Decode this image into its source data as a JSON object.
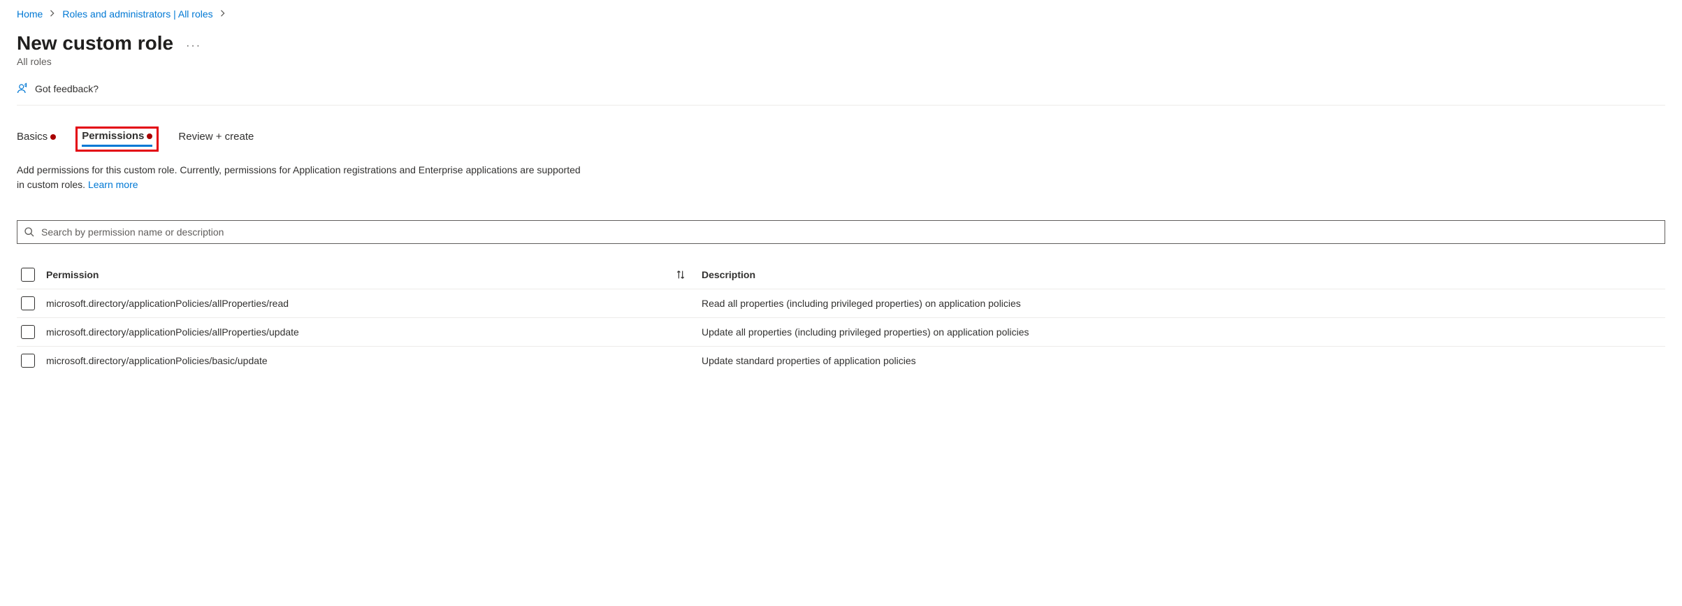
{
  "breadcrumb": {
    "home": "Home",
    "roles": "Roles and administrators | All roles"
  },
  "title": "New custom role",
  "subtitle": "All roles",
  "feedback_label": "Got feedback?",
  "tabs": {
    "basics": "Basics",
    "permissions": "Permissions",
    "review": "Review + create"
  },
  "description": {
    "line1": "Add permissions for this custom role. Currently, permissions for Application registrations and Enterprise applications are supported",
    "line2_prefix": "in custom roles. ",
    "learn_more": "Learn more"
  },
  "search": {
    "placeholder": "Search by permission name or description"
  },
  "table": {
    "headers": {
      "permission": "Permission",
      "description": "Description"
    },
    "rows": [
      {
        "perm": "microsoft.directory/applicationPolicies/allProperties/read",
        "desc": "Read all properties (including privileged properties) on application policies"
      },
      {
        "perm": "microsoft.directory/applicationPolicies/allProperties/update",
        "desc": "Update all properties (including privileged properties) on application policies"
      },
      {
        "perm": "microsoft.directory/applicationPolicies/basic/update",
        "desc": "Update standard properties of application policies"
      }
    ]
  }
}
